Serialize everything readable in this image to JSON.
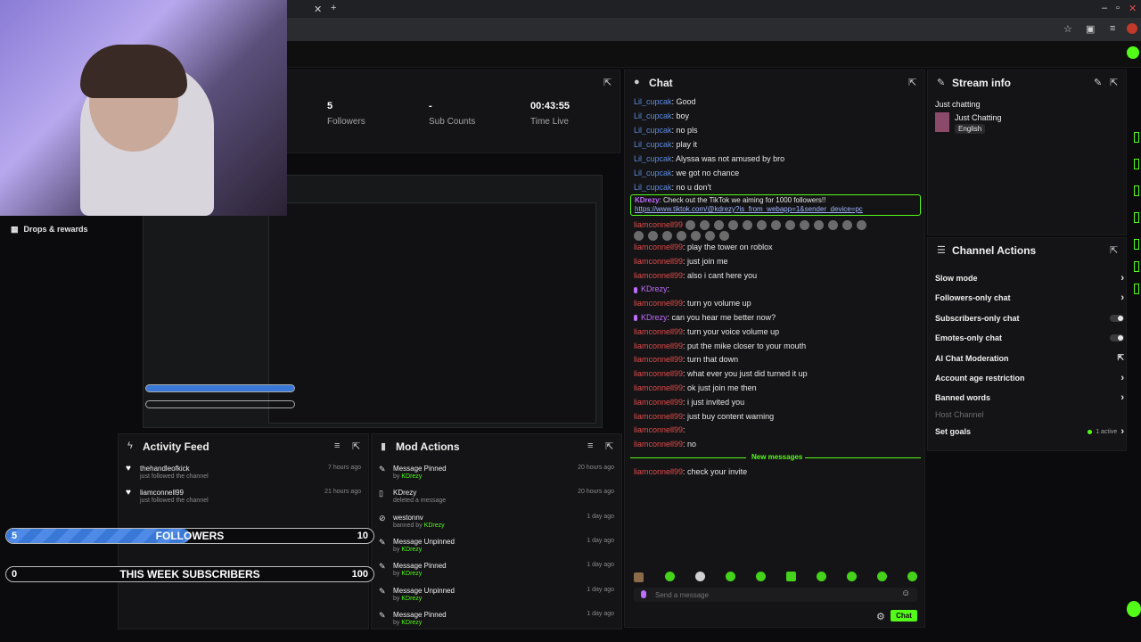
{
  "stats": [
    {
      "value": "5",
      "label": "Followers"
    },
    {
      "value": "-",
      "label": "Sub Counts"
    },
    {
      "value": "00:43:55",
      "label": "Time Live"
    }
  ],
  "drops": {
    "label": "Drops & rewards"
  },
  "chat": {
    "title": "Chat",
    "lines": [
      {
        "user": "Lil_cupcak",
        "msg": ": Good",
        "color": "blue"
      },
      {
        "user": "Lil_cupcak",
        "msg": ": boy",
        "color": "blue"
      },
      {
        "user": "Lil_cupcak",
        "msg": ": no pls",
        "color": "blue"
      },
      {
        "user": "Lil_cupcak",
        "msg": ": play it",
        "color": "blue"
      },
      {
        "user": "Lil_cupcak",
        "msg": ": Alyssa was not amused by bro",
        "color": "blue"
      },
      {
        "user": "Lil_cupcak",
        "msg": ": we got no chance",
        "color": "blue"
      },
      {
        "user": "Lil_cupcak",
        "msg": ": no u don't",
        "color": "blue"
      }
    ],
    "pinned_user": "KDrezy",
    "pinned_msg": ": Check out the TikTok we aiming for 1000 followers!! ",
    "pinned_link": "https://www.tiktok.com/@kdrezy?is_from_webapp=1&sender_device=pc",
    "lines2": [
      {
        "user": "liamconnell99",
        "msg": ": play the tower on roblox",
        "color": "red"
      },
      {
        "user": "liamconnell99",
        "msg": ": just join me",
        "color": "red"
      },
      {
        "user": "liamconnell99",
        "msg": ": also i cant here you",
        "color": "red"
      },
      {
        "user": "KDrezy",
        "msg": ":",
        "color": "purple"
      },
      {
        "user": "liamconnell99",
        "msg": ": turn yo volume up",
        "color": "red"
      },
      {
        "user": "KDrezy",
        "msg": ": can you hear me better now?",
        "color": "purple"
      },
      {
        "user": "liamconnell99",
        "msg": ": turn your voice volume up",
        "color": "red"
      },
      {
        "user": "liamconnell99",
        "msg": ": put the mike closer to your mouth",
        "color": "red"
      },
      {
        "user": "liamconnell99",
        "msg": ": turn that down",
        "color": "red"
      },
      {
        "user": "liamconnell99",
        "msg": ": what ever you just did turned it up",
        "color": "red"
      },
      {
        "user": "liamconnell99",
        "msg": ": ok just join me then",
        "color": "red"
      },
      {
        "user": "liamconnell99",
        "msg": ": i just invited you",
        "color": "red"
      },
      {
        "user": "liamconnell99",
        "msg": ": just buy content warning",
        "color": "red"
      },
      {
        "user": "liamconnell99",
        "msg": ":",
        "color": "red"
      },
      {
        "user": "liamconnell99",
        "msg": ": no",
        "color": "red"
      }
    ],
    "new_messages": "New messages",
    "last_line": {
      "user": "liamconnell99",
      "msg": ": check your invite"
    },
    "placeholder": "Send a message",
    "send_label": "Chat"
  },
  "stream_info": {
    "title": "Stream info",
    "stream_title": "Just chatting",
    "category": "Just Chatting",
    "language": "English"
  },
  "channel_actions": {
    "title": "Channel Actions",
    "items": [
      {
        "label": "Slow mode",
        "control": "arrow"
      },
      {
        "label": "Followers-only chat",
        "control": "arrow"
      },
      {
        "label": "Subscribers-only chat",
        "control": "toggle"
      },
      {
        "label": "Emotes-only chat",
        "control": "toggle"
      },
      {
        "label": "AI Chat Moderation",
        "control": "external"
      },
      {
        "label": "Account age restriction",
        "control": "arrow"
      },
      {
        "label": "Banned words",
        "control": "arrow"
      }
    ],
    "host_channel": "Host Channel",
    "set_goals": "Set goals",
    "active": "1 active"
  },
  "activity_feed": {
    "title": "Activity Feed",
    "items": [
      {
        "name": "thehandleofkick",
        "sub": "just followed the channel",
        "time": "7 hours ago"
      },
      {
        "name": "liamconnell99",
        "sub": "just followed the channel",
        "time": "21 hours ago"
      }
    ]
  },
  "mod_actions": {
    "title": "Mod Actions",
    "items": [
      {
        "action": "Message Pinned",
        "by": "by ",
        "who": "KDrezy",
        "time": "20 hours ago",
        "icon": "pin-icon"
      },
      {
        "action": "KDrezy",
        "by": "deleted a message",
        "who": "",
        "time": "20 hours ago",
        "icon": "trash-icon"
      },
      {
        "action": "westonnv",
        "by": "banned by ",
        "who": "KDrezy",
        "time": "1 day ago",
        "icon": "ban-icon"
      },
      {
        "action": "Message Unpinned",
        "by": "by ",
        "who": "KDrezy",
        "time": "1 day ago",
        "icon": "pin-icon"
      },
      {
        "action": "Message Pinned",
        "by": "by ",
        "who": "KDrezy",
        "time": "1 day ago",
        "icon": "pin-icon"
      },
      {
        "action": "Message Unpinned",
        "by": "by ",
        "who": "KDrezy",
        "time": "1 day ago",
        "icon": "pin-icon"
      },
      {
        "action": "Message Pinned",
        "by": "by ",
        "who": "KDrezy",
        "time": "1 day ago",
        "icon": "pin-icon"
      }
    ]
  },
  "goals": {
    "followers": {
      "current": "5",
      "label": "FOLLOWERS",
      "target": "10",
      "progress": 0.5
    },
    "subs": {
      "current": "0",
      "label": "THIS WEEK SUBSCRIBERS",
      "target": "100",
      "progress": 0.0
    }
  },
  "colors": {
    "accent": "#53fc18",
    "bar_fill": "#3a78d8"
  }
}
